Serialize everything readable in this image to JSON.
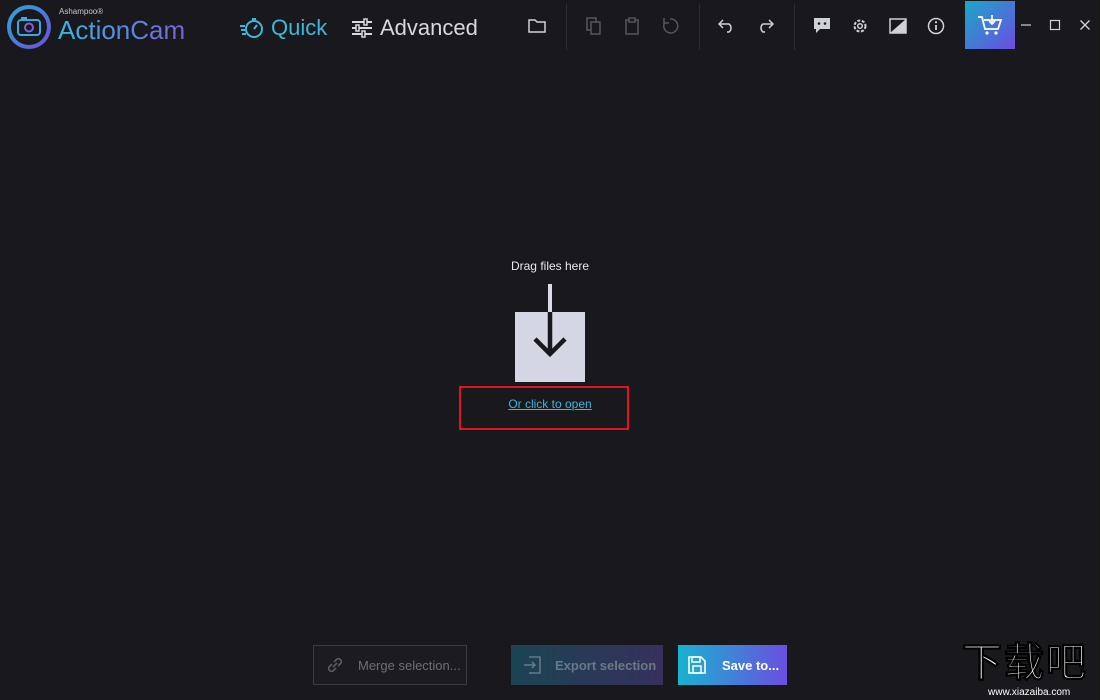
{
  "app": {
    "brand_small": "Ashampoo®",
    "title": "ActionCam"
  },
  "modes": {
    "quick": "Quick",
    "advanced": "Advanced"
  },
  "toolbar": {
    "icons": [
      "folder-icon",
      "copy-icon",
      "paste-icon",
      "reset-icon",
      "undo-icon",
      "redo-icon",
      "feedback-icon",
      "settings-icon",
      "compare-icon",
      "info-icon",
      "cart-icon"
    ]
  },
  "dropzone": {
    "label": "Drag files here",
    "open_link": "Or click to open"
  },
  "actions": {
    "merge": "Merge selection...",
    "export": "Export selection",
    "save": "Save to..."
  },
  "watermark": {
    "big": "下载吧",
    "small": "www.xiazaiba.com"
  },
  "colors": {
    "background": "#18181d",
    "accent": "#3bb6dd",
    "accent_purple": "#6a4fe0",
    "highlight": "#e0141a"
  }
}
